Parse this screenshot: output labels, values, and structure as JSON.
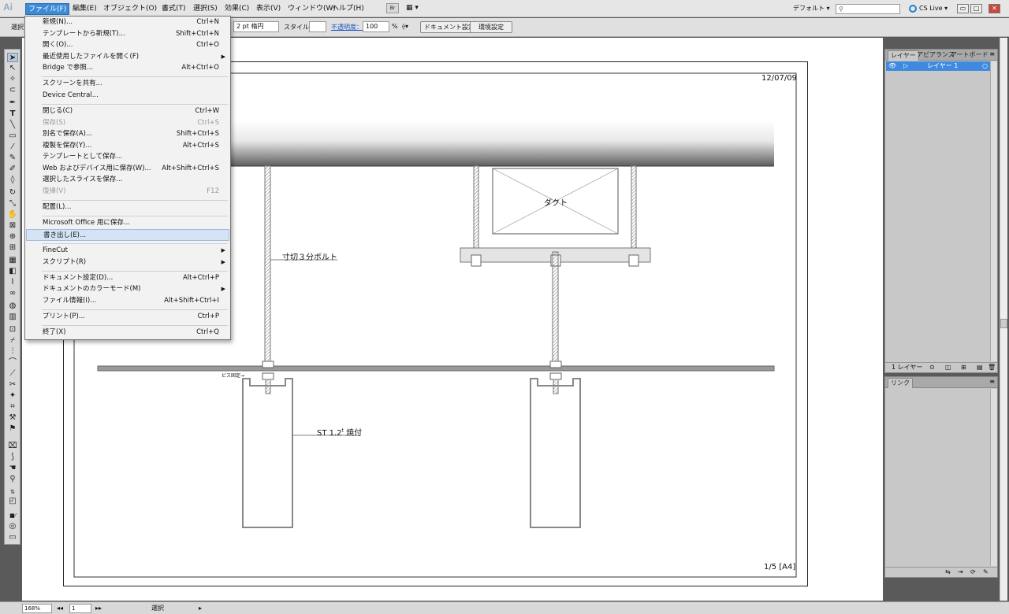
{
  "menubar": {
    "app_icon": "Ai",
    "items": [
      {
        "label": "ファイル(F)",
        "active": true
      },
      {
        "label": "編集(E)"
      },
      {
        "label": "オブジェクト(O)"
      },
      {
        "label": "書式(T)"
      },
      {
        "label": "選択(S)"
      },
      {
        "label": "効果(C)"
      },
      {
        "label": "表示(V)"
      },
      {
        "label": "ウィンドウ(W)"
      },
      {
        "label": "ヘルプ(H)"
      }
    ],
    "bridge_label": "Br",
    "workspace": "デフォルト ▾",
    "search_placeholder": "",
    "cs_live": "CS Live ▾",
    "window_buttons": [
      "▭",
      "□",
      "✕"
    ]
  },
  "control_bar": {
    "selection_label": "選択",
    "stroke_value": "2 pt 楕円",
    "style_label": "スタイル：",
    "opacity_label": "不透明度：",
    "opacity_value": "100",
    "opacity_unit": "%",
    "doc_setup_button": "ドキュメント設定",
    "preferences_button": "環境設定"
  },
  "file_menu": [
    {
      "label": "新規(N)...",
      "shortcut": "Ctrl+N"
    },
    {
      "label": "テンプレートから新規(T)...",
      "shortcut": "Shift+Ctrl+N"
    },
    {
      "label": "開く(O)...",
      "shortcut": "Ctrl+O"
    },
    {
      "label": "最近使用したファイルを開く(F)",
      "submenu": true
    },
    {
      "label": "Bridge で参照...",
      "shortcut": "Alt+Ctrl+O"
    },
    {
      "separator": true
    },
    {
      "label": "スクリーンを共有..."
    },
    {
      "label": "Device Central..."
    },
    {
      "separator": true
    },
    {
      "label": "閉じる(C)",
      "shortcut": "Ctrl+W"
    },
    {
      "label": "保存(S)",
      "shortcut": "Ctrl+S",
      "disabled": true
    },
    {
      "label": "別名で保存(A)...",
      "shortcut": "Shift+Ctrl+S"
    },
    {
      "label": "複製を保存(Y)...",
      "shortcut": "Alt+Ctrl+S"
    },
    {
      "label": "テンプレートとして保存..."
    },
    {
      "label": "Web およびデバイス用に保存(W)...",
      "shortcut": "Alt+Shift+Ctrl+S"
    },
    {
      "label": "選択したスライスを保存..."
    },
    {
      "label": "復帰(V)",
      "shortcut": "F12",
      "disabled": true
    },
    {
      "separator": true
    },
    {
      "label": "配置(L)..."
    },
    {
      "separator": true
    },
    {
      "label": "Microsoft Office 用に保存..."
    },
    {
      "label": "書き出し(E)...",
      "highlighted": true
    },
    {
      "separator": true
    },
    {
      "label": "FineCut",
      "submenu": true
    },
    {
      "label": "スクリプト(R)",
      "submenu": true
    },
    {
      "separator": true
    },
    {
      "label": "ドキュメント設定(D)...",
      "shortcut": "Alt+Ctrl+P"
    },
    {
      "label": "ドキュメントのカラーモード(M)",
      "submenu": true
    },
    {
      "label": "ファイル情報(I)...",
      "shortcut": "Alt+Shift+Ctrl+I"
    },
    {
      "separator": true
    },
    {
      "label": "プリント(P)...",
      "shortcut": "Ctrl+P"
    },
    {
      "separator": true
    },
    {
      "label": "終了(X)",
      "shortcut": "Ctrl+Q"
    }
  ],
  "drawing": {
    "date": "12/07/09",
    "page": "1/5 [A4]",
    "duct_label": "ダクト",
    "bolt_label": "寸切３分ボルト",
    "st_label": "ST 1.2",
    "st_sup": "t",
    "st_suffix": " 焼付",
    "screw_label": "ビス固定→"
  },
  "layers_panel": {
    "tabs": [
      "レイヤー",
      "アピアランス",
      "アートボード"
    ],
    "layer_name": "レイヤー 1",
    "footer": "1 レイヤー"
  },
  "links_panel": {
    "tabs": [
      "リンク"
    ]
  },
  "status_bar": {
    "zoom": "168%",
    "page": "1",
    "tool": "選択"
  },
  "colors": {
    "menu_active": "#3d8ad6",
    "layer_highlight": "#3f8ae0",
    "menu_highlight": "#d5e4f5"
  }
}
